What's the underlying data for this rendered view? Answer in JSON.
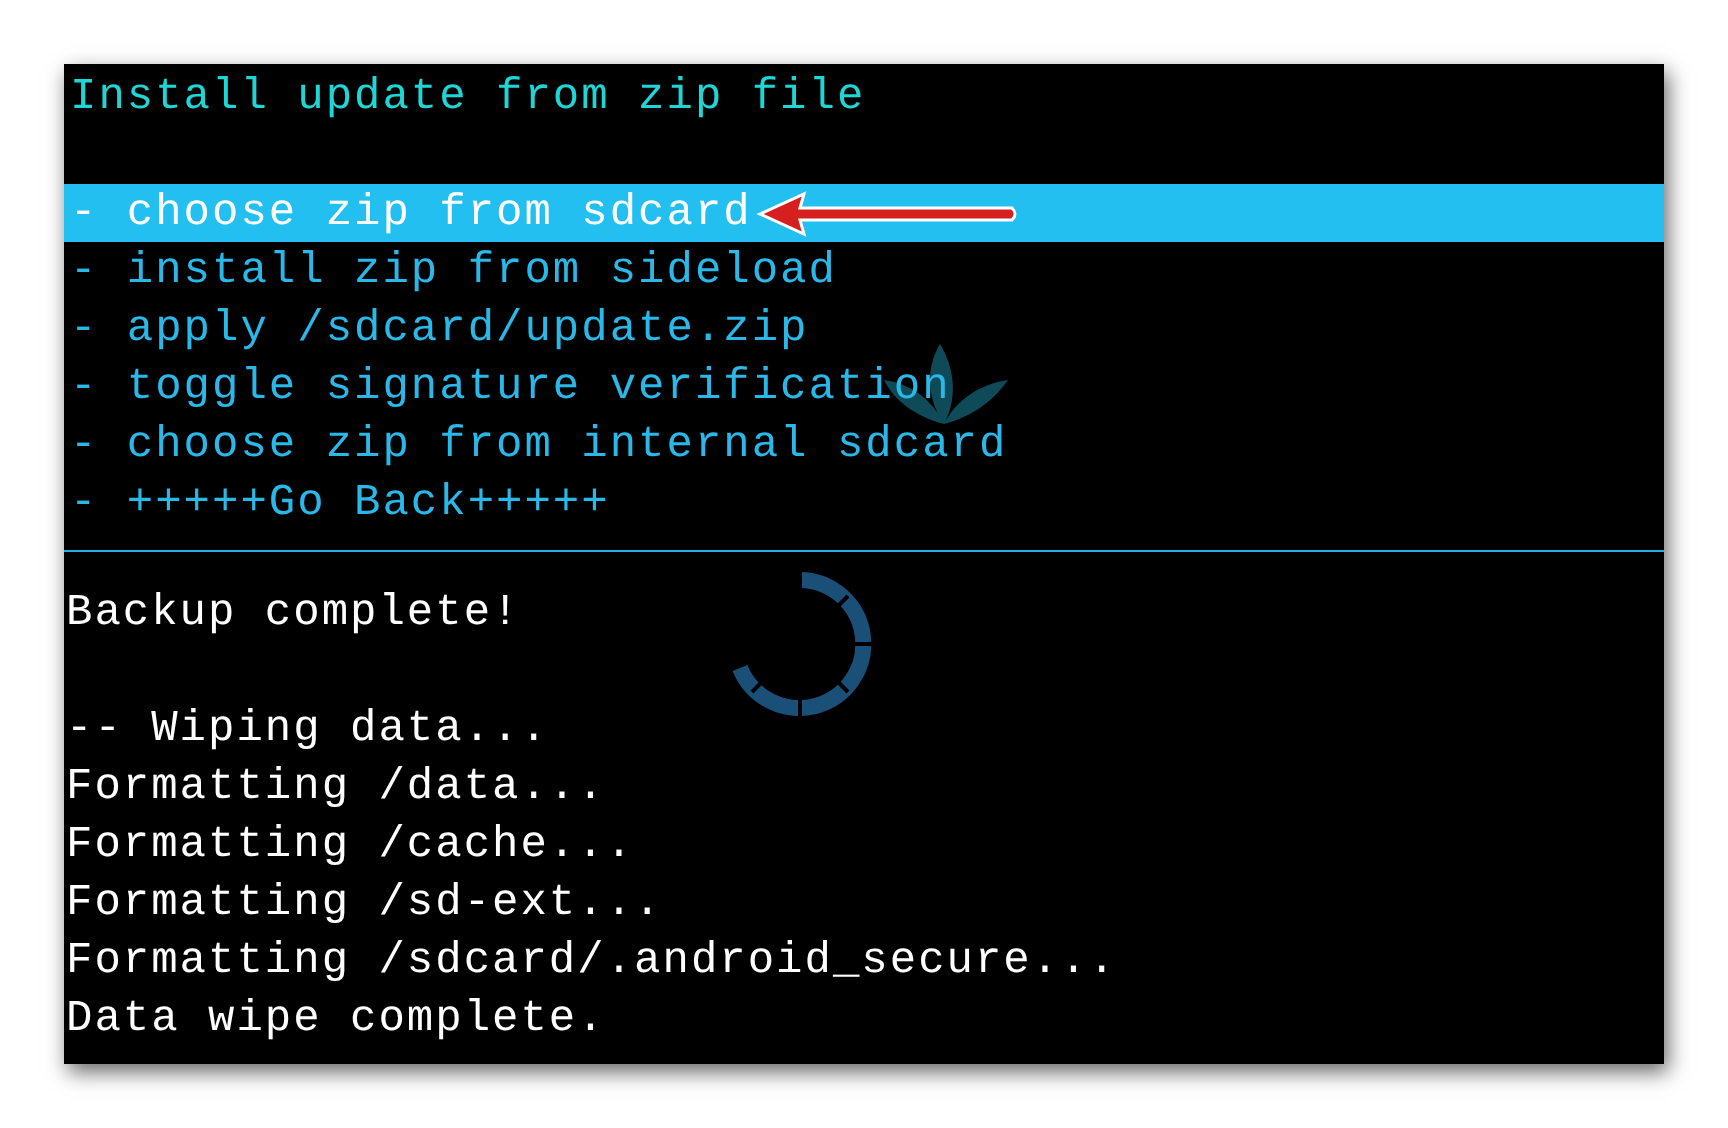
{
  "header": {
    "title": "Install update from zip file"
  },
  "menu": [
    {
      "label": "- choose zip from sdcard",
      "selected": true
    },
    {
      "label": "- install zip from sideload",
      "selected": false
    },
    {
      "label": "- apply /sdcard/update.zip",
      "selected": false
    },
    {
      "label": "- toggle signature verification",
      "selected": false
    },
    {
      "label": "- choose zip from internal sdcard",
      "selected": false
    },
    {
      "label": "- +++++Go Back+++++",
      "selected": false
    }
  ],
  "log": [
    [
      "Backup complete!"
    ],
    [
      "-- Wiping data...",
      "Formatting /data...",
      "Formatting /cache...",
      "Formatting /sd-ext...",
      "Formatting /sdcard/.android_secure...",
      "Data wipe complete."
    ]
  ]
}
